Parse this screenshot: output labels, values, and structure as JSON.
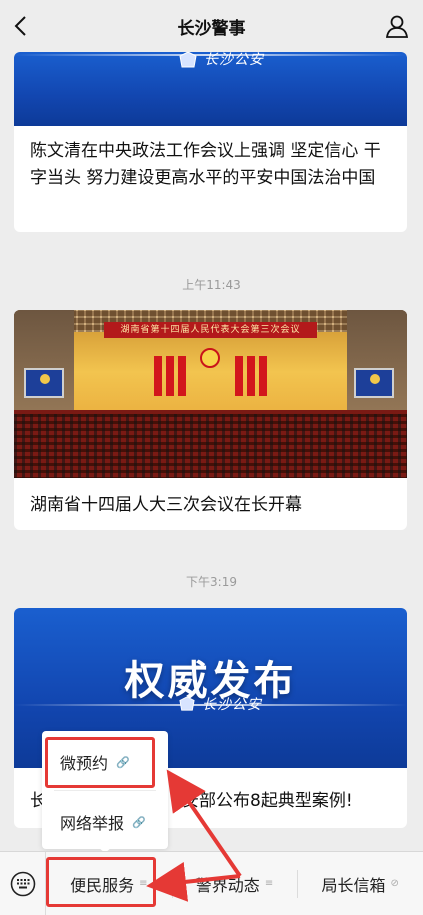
{
  "header": {
    "title": "长沙警事"
  },
  "feed": {
    "card1": {
      "title": "陈文清在中央政法工作会议上强调 坚定信心 干字当头 努力建设更高水平的平安中国法治中国"
    },
    "time1": "上午11:43",
    "card2": {
      "banner_text": "湖南省第十四届人民代表大会第三次会议",
      "title": "湖南省十四届人大三次会议在长开幕"
    },
    "time2": "下午3:19",
    "card3": {
      "banner_heading": "权威发布",
      "title_left": "长",
      "title_right": "安部公布8起典型案例!"
    }
  },
  "menu": {
    "items": [
      {
        "label": "便民服务",
        "suffix": "≡"
      },
      {
        "label": "警界动态",
        "suffix": "≡"
      },
      {
        "label": "局长信箱",
        "suffix": "⊘"
      }
    ],
    "popup": [
      {
        "label": "微预约"
      },
      {
        "label": "网络举报"
      }
    ]
  },
  "colors": {
    "highlight": "#e53935",
    "banner_blue": "#1a5fcf",
    "background": "#ededed"
  },
  "icons": {
    "back": "chevron-left-icon",
    "user": "user-icon",
    "keyboard": "keyboard-icon",
    "link": "link-icon"
  }
}
